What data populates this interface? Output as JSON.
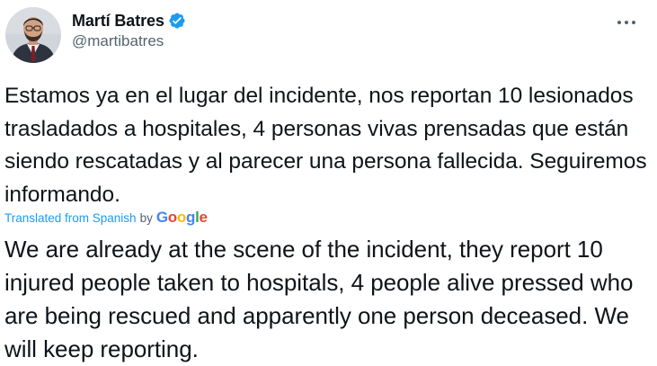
{
  "author": {
    "name": "Martí Batres",
    "handle": "@martibatres",
    "verified": true
  },
  "icons": {
    "avatar": "profile-photo",
    "verified": "verified-badge-icon",
    "more": "more-horizontal-icon"
  },
  "tweet": {
    "text": "Estamos ya en el lugar del incidente, nos reportan 10 lesionados trasladados a hospitales, 4 personas vivas prensadas que están siendo rescatadas y al parecer una persona fallecida. Seguiremos informando.",
    "translation_label": "Translated from Spanish",
    "translation_by": "by",
    "translation_provider": "Google",
    "translation": "We are already at the scene of the incident, they report 10 injured people taken to hospitals, 4 people alive pressed who are being rescued and apparently one person deceased. We will keep reporting."
  },
  "colors": {
    "accent": "#1d9bf0",
    "text": "#0f1419",
    "secondary": "#536471"
  }
}
